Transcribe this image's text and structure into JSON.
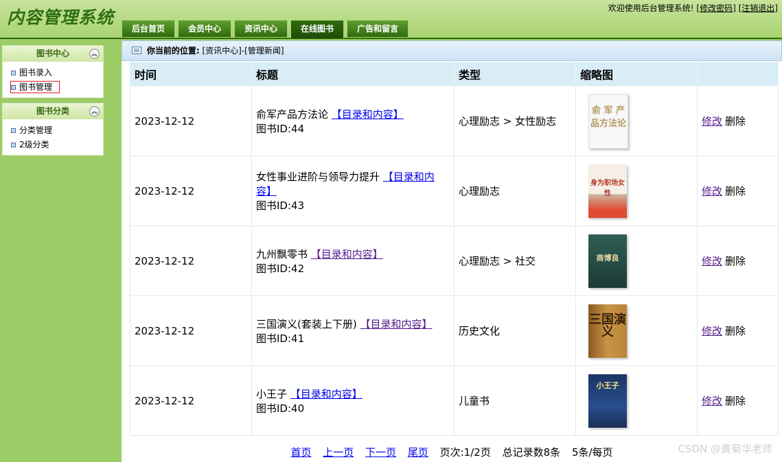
{
  "app": {
    "logo": "内容管理系统",
    "welcome_text": "欢迎使用后台管理系统!",
    "change_password": "[修改密码]",
    "logout": "[注销退出]"
  },
  "tabs": [
    {
      "label": "后台首页",
      "active": false
    },
    {
      "label": "会员中心",
      "active": false
    },
    {
      "label": "资讯中心",
      "active": false
    },
    {
      "label": "在线图书",
      "active": true
    },
    {
      "label": "广告和留言",
      "active": false
    }
  ],
  "sidebar": {
    "sections": [
      {
        "title": "图书中心",
        "items": [
          {
            "label": "图书录入",
            "selected": false
          },
          {
            "label": "图书管理",
            "selected": true
          }
        ]
      },
      {
        "title": "图书分类",
        "items": [
          {
            "label": "分类管理",
            "selected": false
          },
          {
            "label": "2级分类",
            "selected": false
          }
        ]
      }
    ]
  },
  "breadcrumb": {
    "label": "你当前的位置:",
    "path": "[资讯中心]-[管理新闻]"
  },
  "table": {
    "headers": [
      "时间",
      "标题",
      "类型",
      "缩略图",
      ""
    ],
    "toc_link": "【目录和内容】",
    "id_prefix": "图书ID:",
    "edit_label": "修改",
    "delete_label": "删除",
    "rows": [
      {
        "date": "2023-12-12",
        "title": "俞军产品方法论",
        "book_id": "44",
        "type": "心理励志 > 女性励志",
        "cover_text": "俞 军 产品方法论"
      },
      {
        "date": "2023-12-12",
        "title": "女性事业进阶与领导力提升",
        "book_id": "43",
        "type": "心理励志",
        "cover_text": "身为职场女性"
      },
      {
        "date": "2023-12-12",
        "title": "九州飘零书",
        "book_id": "42",
        "type": "心理励志 > 社交",
        "cover_text": "商博良"
      },
      {
        "date": "2023-12-12",
        "title": "三国演义(套装上下册)",
        "book_id": "41",
        "type": "历史文化",
        "cover_text": "三国演义"
      },
      {
        "date": "2023-12-12",
        "title": "小王子",
        "book_id": "40",
        "type": "儿童书",
        "cover_text": "小王子"
      }
    ]
  },
  "pager": {
    "first": "首页",
    "prev": "上一页",
    "next": "下一页",
    "last": "尾页",
    "page_info": "页次:1/2页",
    "total": "总记录数8条",
    "per_page": "5条/每页"
  },
  "watermark": "CSDN @黄菊华老师"
}
